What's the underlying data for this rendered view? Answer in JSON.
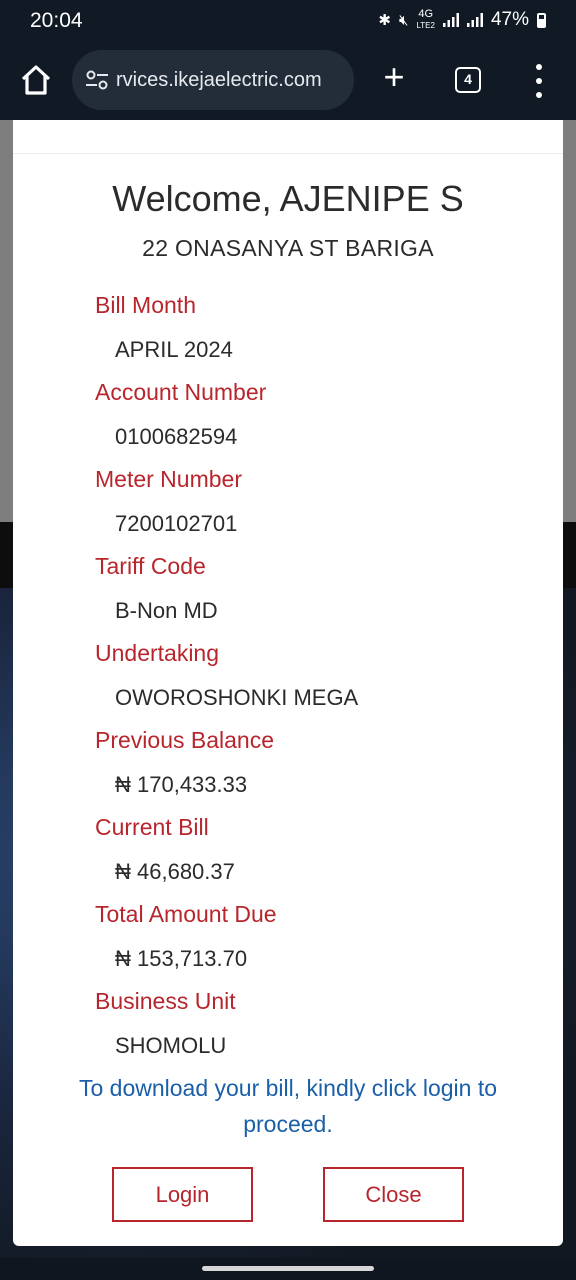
{
  "status_bar": {
    "time": "20:04",
    "network_label_top": "4G",
    "network_label_bottom": "LTE2",
    "battery_percent": "47%",
    "icons": [
      "bluetooth-icon",
      "mute-icon",
      "signal-icon",
      "signal-icon",
      "battery-icon"
    ]
  },
  "browser": {
    "url": "rvices.ikejaelectric.com",
    "tab_count": "4",
    "icons": [
      "home-icon",
      "site-settings-icon",
      "new-tab-icon",
      "tab-switcher-icon",
      "more-menu-icon"
    ]
  },
  "modal": {
    "welcome": "Welcome, AJENIPE S",
    "address": "22 ONASANYA ST BARIGA",
    "fields": [
      {
        "label": "Bill Month",
        "value": "APRIL 2024"
      },
      {
        "label": "Account Number",
        "value": "0100682594"
      },
      {
        "label": "Meter Number",
        "value": "7200102701"
      },
      {
        "label": "Tariff Code",
        "value": "B-Non MD"
      },
      {
        "label": "Undertaking",
        "value": "OWOROSHONKI MEGA"
      },
      {
        "label": "Previous Balance",
        "value": "₦ 170,433.33"
      },
      {
        "label": "Current Bill",
        "value": "₦ 46,680.37"
      },
      {
        "label": "Total Amount Due",
        "value": "₦ 153,713.70"
      },
      {
        "label": "Business Unit",
        "value": "SHOMOLU"
      }
    ],
    "note": "To download your bill, kindly click login to proceed.",
    "login_label": "Login",
    "close_label": "Close"
  },
  "colors": {
    "label_red": "#b8262d",
    "note_blue": "#1a5fa8",
    "toolbar_dark": "#111a24"
  }
}
